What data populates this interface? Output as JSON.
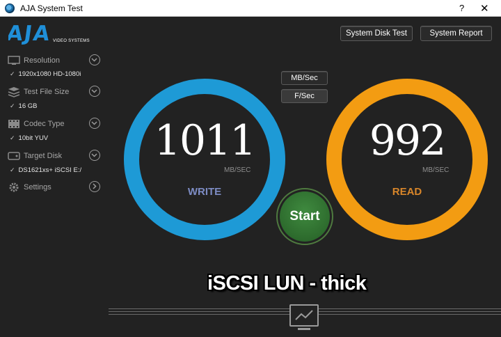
{
  "window": {
    "title": "AJA System Test",
    "help": "?",
    "close": "✕"
  },
  "logo": {
    "text": "AJA",
    "subtitle": "VIDEO SYSTEMS"
  },
  "sidebar": {
    "items": [
      {
        "label": "Resolution",
        "value": "1920x1080 HD-1080i",
        "icon": "monitor-icon"
      },
      {
        "label": "Test File Size",
        "value": "16 GB",
        "icon": "stack-icon"
      },
      {
        "label": "Codec Type",
        "value": "10bit YUV",
        "icon": "film-icon"
      },
      {
        "label": "Target Disk",
        "value": "DS1621xs+ iSCSI E:/",
        "icon": "disk-icon"
      },
      {
        "label": "Settings",
        "value": "",
        "icon": "gear-icon"
      }
    ],
    "check_mark": "✓"
  },
  "toolbar": {
    "system_disk_test": "System Disk Test",
    "system_report": "System Report"
  },
  "units": {
    "mb_sec": "MB/Sec",
    "f_sec": "F/Sec"
  },
  "write": {
    "value": "1011",
    "unit": "MB/SEC",
    "label": "WRITE",
    "color": "#1e9ad6"
  },
  "read": {
    "value": "992",
    "unit": "MB/SEC",
    "label": "READ",
    "color": "#f39c12"
  },
  "start": {
    "label": "Start"
  },
  "caption": "iSCSI LUN - thick"
}
